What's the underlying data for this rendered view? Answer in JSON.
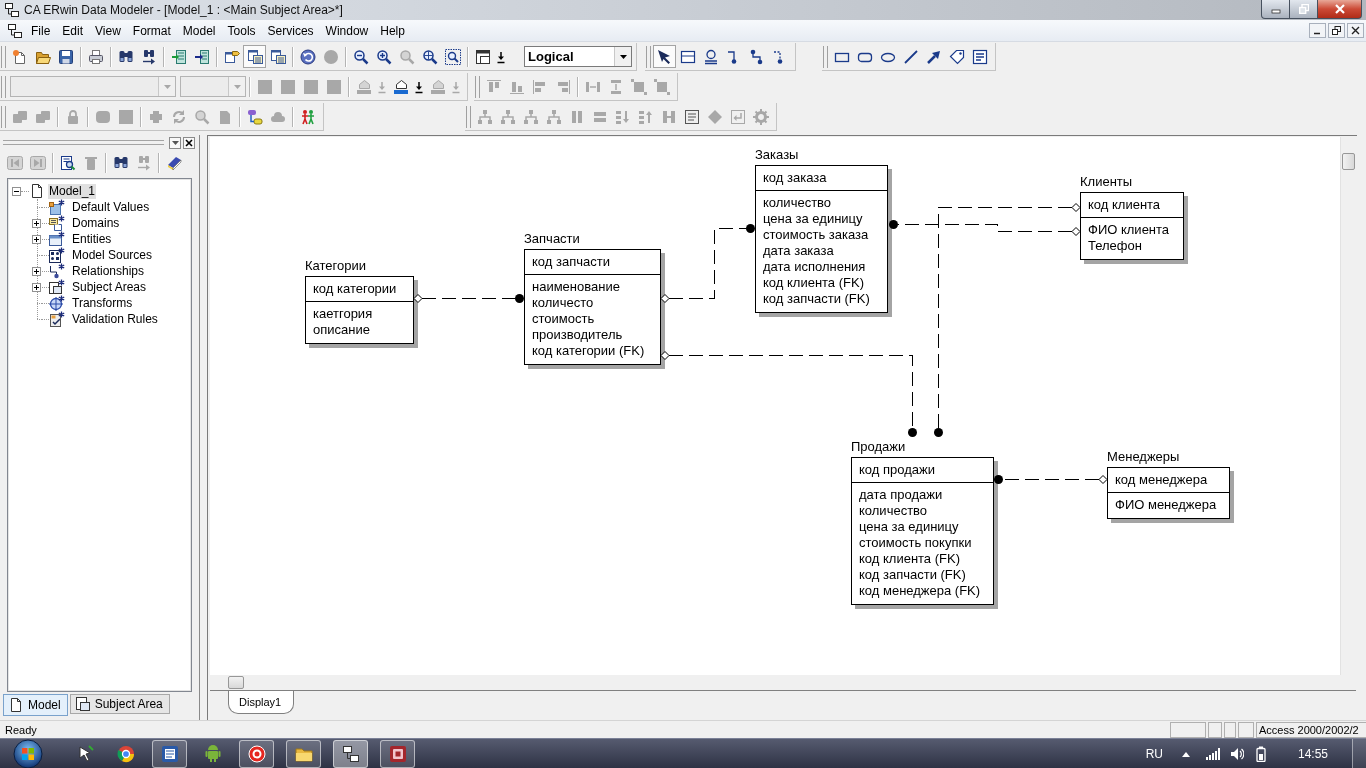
{
  "window": {
    "title": "CA ERwin Data Modeler - [Model_1 : <Main Subject Area>*]"
  },
  "menu": [
    "File",
    "Edit",
    "View",
    "Format",
    "Model",
    "Tools",
    "Services",
    "Window",
    "Help"
  ],
  "toolbars": [
    {
      "bands": [
        {
          "groups": [
            [
              {
                "kind": "button",
                "disabled": false,
                "pressed": false
              },
              {
                "kind": "button",
                "disabled": false,
                "pressed": false
              },
              {
                "kind": "button",
                "disabled": false,
                "pressed": false
              }
            ],
            [
              {
                "kind": "button",
                "disabled": false,
                "pressed": false
              }
            ],
            [
              {
                "kind": "button",
                "disabled": false,
                "pressed": false
              },
              {
                "kind": "button",
                "disabled": false,
                "pressed": false
              }
            ],
            [
              {
                "kind": "button",
                "disabled": false,
                "pressed": false
              },
              {
                "kind": "button",
                "disabled": false,
                "pressed": false
              }
            ],
            [
              {
                "kind": "button",
                "disabled": false,
                "pressed": false
              },
              {
                "kind": "button",
                "disabled": false,
                "pressed": true
              },
              {
                "kind": "button",
                "disabled": false,
                "pressed": false
              }
            ],
            [
              {
                "kind": "button",
                "disabled": false,
                "pressed": false
              },
              {
                "kind": "button",
                "disabled": true,
                "pressed": false
              }
            ],
            [
              {
                "kind": "button",
                "disabled": false,
                "pressed": false
              },
              {
                "kind": "button",
                "disabled": false,
                "pressed": false
              },
              {
                "kind": "button",
                "disabled": true,
                "pressed": false
              },
              {
                "kind": "button",
                "disabled": false,
                "pressed": false
              },
              {
                "kind": "button",
                "disabled": false,
                "pressed": false
              }
            ],
            [
              {
                "kind": "button",
                "disabled": false,
                "pressed": false
              },
              {
                "kind": "arrow",
                "disabled": false,
                "pressed": false
              },
              {
                "kind": "combo",
                "value": "Logical",
                "disabled": false
              }
            ]
          ]
        },
        {
          "groups": [
            [
              {
                "kind": "button",
                "disabled": false,
                "pressed": true
              },
              {
                "kind": "button",
                "disabled": false,
                "pressed": false
              },
              {
                "kind": "button",
                "disabled": false,
                "pressed": false
              },
              {
                "kind": "button",
                "disabled": false,
                "pressed": false
              },
              {
                "kind": "button",
                "disabled": false,
                "pressed": false
              },
              {
                "kind": "button",
                "disabled": false,
                "pressed": false
              }
            ]
          ]
        },
        {
          "groups": [
            [
              {
                "kind": "button",
                "disabled": false,
                "pressed": false
              },
              {
                "kind": "button",
                "disabled": false,
                "pressed": false
              },
              {
                "kind": "button",
                "disabled": false,
                "pressed": false
              },
              {
                "kind": "button",
                "disabled": false,
                "pressed": false
              },
              {
                "kind": "button",
                "disabled": false,
                "pressed": false
              },
              {
                "kind": "button",
                "disabled": false,
                "pressed": false
              },
              {
                "kind": "button",
                "disabled": false,
                "pressed": false
              }
            ]
          ]
        }
      ]
    },
    {
      "bands": [
        {
          "groups": [
            [
              {
                "kind": "combo",
                "disabled": true
              },
              {
                "kind": "combo",
                "disabled": true
              }
            ],
            [
              {
                "kind": "button",
                "disabled": true,
                "pressed": false
              },
              {
                "kind": "button",
                "disabled": true,
                "pressed": false
              },
              {
                "kind": "button",
                "disabled": true,
                "pressed": false
              },
              {
                "kind": "button",
                "disabled": true,
                "pressed": false
              }
            ],
            [
              {
                "kind": "button",
                "disabled": true,
                "pressed": false
              },
              {
                "kind": "arrow",
                "disabled": true,
                "pressed": false
              },
              {
                "kind": "button",
                "disabled": false,
                "pressed": false
              },
              {
                "kind": "arrow",
                "disabled": false,
                "pressed": false
              },
              {
                "kind": "button",
                "disabled": true,
                "pressed": false
              },
              {
                "kind": "arrow",
                "disabled": true,
                "pressed": false
              }
            ]
          ]
        },
        {
          "groups": [
            [
              {
                "kind": "button",
                "disabled": true,
                "pressed": false
              },
              {
                "kind": "button",
                "disabled": true,
                "pressed": false
              },
              {
                "kind": "button",
                "disabled": true,
                "pressed": false
              },
              {
                "kind": "button",
                "disabled": true,
                "pressed": false
              }
            ],
            [
              {
                "kind": "button",
                "disabled": true,
                "pressed": false
              },
              {
                "kind": "button",
                "disabled": true,
                "pressed": false
              },
              {
                "kind": "button",
                "disabled": true,
                "pressed": false
              },
              {
                "kind": "button",
                "disabled": true,
                "pressed": false
              }
            ]
          ]
        }
      ]
    },
    {
      "bands": [
        {
          "groups": [
            [
              {
                "kind": "button",
                "disabled": true,
                "pressed": false
              },
              {
                "kind": "button",
                "disabled": true,
                "pressed": false
              }
            ],
            [
              {
                "kind": "button",
                "disabled": true,
                "pressed": false
              }
            ],
            [
              {
                "kind": "button",
                "disabled": true,
                "pressed": false
              },
              {
                "kind": "button",
                "disabled": true,
                "pressed": false
              }
            ],
            [
              {
                "kind": "button",
                "disabled": true,
                "pressed": false
              },
              {
                "kind": "button",
                "disabled": true,
                "pressed": false
              },
              {
                "kind": "button",
                "disabled": true,
                "pressed": false
              },
              {
                "kind": "button",
                "disabled": true,
                "pressed": false
              }
            ],
            [
              {
                "kind": "button",
                "disabled": false,
                "pressed": false
              },
              {
                "kind": "button",
                "disabled": true,
                "pressed": false
              }
            ],
            [
              {
                "kind": "button",
                "disabled": false,
                "pressed": false
              }
            ]
          ]
        },
        {
          "groups": [
            [
              {
                "kind": "button",
                "disabled": true,
                "pressed": false
              },
              {
                "kind": "button",
                "disabled": true,
                "pressed": false
              },
              {
                "kind": "button",
                "disabled": true,
                "pressed": false
              },
              {
                "kind": "button",
                "disabled": true,
                "pressed": false
              },
              {
                "kind": "button",
                "disabled": true,
                "pressed": false
              },
              {
                "kind": "button",
                "disabled": true,
                "pressed": false
              },
              {
                "kind": "button",
                "disabled": true,
                "pressed": false
              },
              {
                "kind": "button",
                "disabled": true,
                "pressed": false
              },
              {
                "kind": "button",
                "disabled": true,
                "pressed": false
              },
              {
                "kind": "button",
                "disabled": false,
                "pressed": false
              },
              {
                "kind": "button",
                "disabled": true,
                "pressed": false
              },
              {
                "kind": "button",
                "disabled": true,
                "pressed": false
              },
              {
                "kind": "button",
                "disabled": true,
                "pressed": false
              }
            ]
          ]
        }
      ]
    }
  ],
  "explorer": {
    "toolbar": [
      [
        {
          "disabled": true
        },
        {
          "disabled": true
        }
      ],
      [
        {
          "disabled": false
        },
        {
          "disabled": true
        }
      ],
      [
        {
          "disabled": false
        },
        {
          "disabled": true
        }
      ],
      [
        {
          "disabled": false
        }
      ]
    ],
    "tree": {
      "label": "Model_1",
      "expanded": true,
      "selected": true,
      "children": [
        {
          "label": "Default Values",
          "expandable": false,
          "selected": false
        },
        {
          "label": "Domains",
          "expandable": true,
          "selected": false
        },
        {
          "label": "Entities",
          "expandable": true,
          "selected": false
        },
        {
          "label": "Model Sources",
          "expandable": false,
          "selected": false
        },
        {
          "label": "Relationships",
          "expandable": true,
          "selected": false
        },
        {
          "label": "Subject Areas",
          "expandable": true,
          "selected": false
        },
        {
          "label": "Transforms",
          "expandable": false,
          "selected": false
        },
        {
          "label": "Validation Rules",
          "expandable": false,
          "selected": false
        }
      ]
    },
    "tabs": [
      {
        "label": "Model",
        "selected": true
      },
      {
        "label": "Subject Area",
        "selected": false
      }
    ]
  },
  "diagram": {
    "entities": [
      {
        "name": "Категории",
        "keys": [
          "код категории"
        ],
        "attributes": [
          "каетгория",
          "описание"
        ]
      },
      {
        "name": "Запчасти",
        "keys": [
          "код запчасти"
        ],
        "attributes": [
          "наименование",
          "количесто",
          "стоимость",
          "производитель",
          "код категории (FK)"
        ]
      },
      {
        "name": "Заказы",
        "keys": [
          "код заказа"
        ],
        "attributes": [
          "количество",
          "цена за единицу",
          "стоимость заказа",
          "дата заказа",
          "дата исполнения",
          "код клиента (FK)",
          "код запчасти (FK)"
        ]
      },
      {
        "name": "Клиенты",
        "keys": [
          "код клиента"
        ],
        "attributes": [
          "ФИО клиента",
          "Телефон"
        ]
      },
      {
        "name": "Продажи",
        "keys": [
          "код продажи"
        ],
        "attributes": [
          "дата продажи",
          "количество",
          "цена за единицу",
          "стоимость покупки",
          "код клиента (FK)",
          "код запчасти (FK)",
          "код менеджера (FK)"
        ]
      },
      {
        "name": "Менеджеры",
        "keys": [
          "код менеджера"
        ],
        "attributes": [
          "ФИО менеджера"
        ]
      }
    ],
    "tabs": [
      {
        "label": "Display1",
        "selected": true
      }
    ]
  },
  "status_bar": {
    "message": "Ready",
    "database": "Access 2000/2002/2"
  },
  "taskbar": {
    "apps": [
      {
        "running": false,
        "selected": false
      },
      {
        "running": false,
        "selected": false
      },
      {
        "running": true,
        "selected": false
      },
      {
        "running": false,
        "selected": false
      },
      {
        "running": true,
        "selected": false
      },
      {
        "running": true,
        "selected": false
      },
      {
        "running": true,
        "selected": true
      },
      {
        "running": true,
        "selected": false
      }
    ],
    "language": "RU",
    "clock": "14:55"
  }
}
